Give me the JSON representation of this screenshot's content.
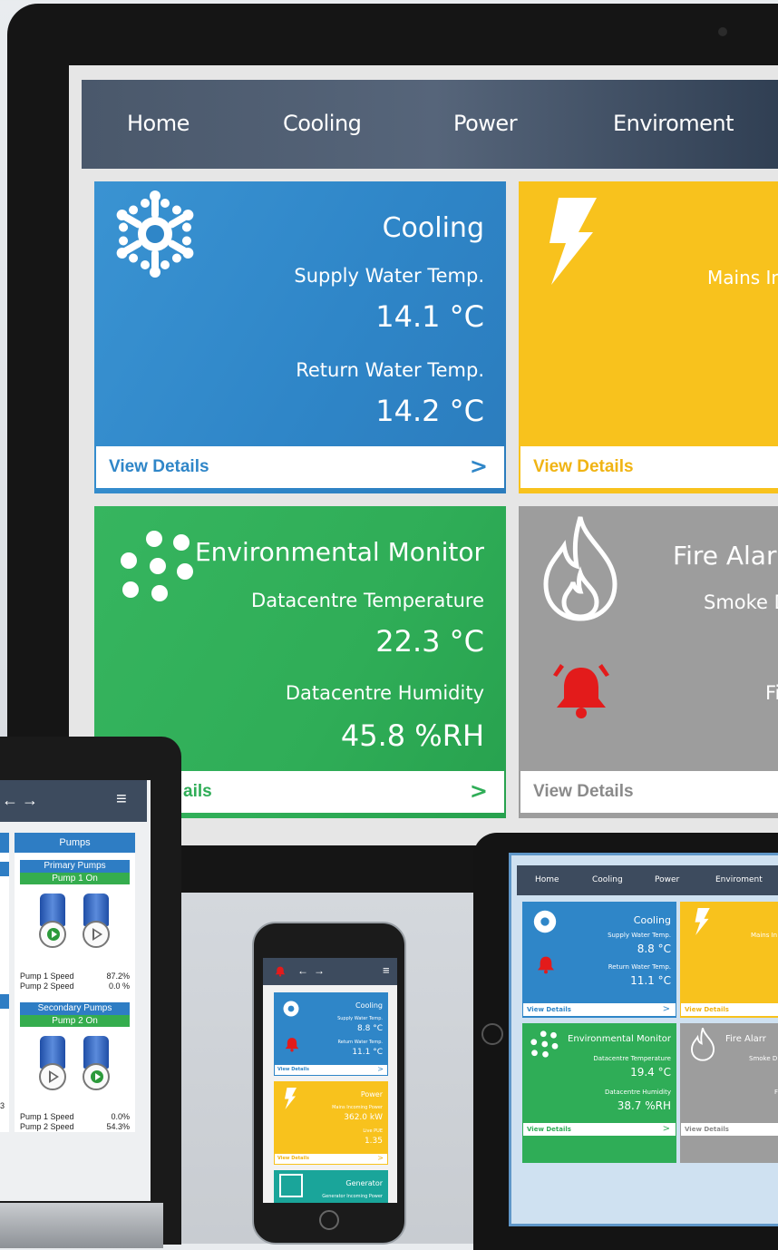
{
  "colors": {
    "cooling": "#2f86c8",
    "power": "#f8c21d",
    "environment": "#2fad57",
    "fire": "#9d9d9d",
    "nav": "#3d4b5e",
    "alarm": "#e31b1b"
  },
  "monitor": {
    "nav": [
      "Home",
      "Cooling",
      "Power",
      "Enviroment"
    ],
    "cooling": {
      "title": "Cooling",
      "label1": "Supply Water Temp.",
      "value1": "14.1 °C",
      "label2": "Return Water Temp.",
      "value2": "14.2 °C",
      "details": "View Details",
      "arrow": ">"
    },
    "power": {
      "label1": "Mains In",
      "details": "View Details"
    },
    "environment": {
      "title": "Environmental Monitor",
      "label1": "Datacentre Temperature",
      "value1": "22.3 °C",
      "label2": "Datacentre Humidity",
      "value2": "45.8 %RH",
      "details": "ails",
      "arrow": ">"
    },
    "fire": {
      "title": "Fire Alarr",
      "label1": "Smoke D",
      "label2": "Fi",
      "details": "View Details"
    }
  },
  "laptop": {
    "nav_back": "←",
    "nav_forward": "→",
    "menu": "≡",
    "panel_title": "Pumps",
    "primary": {
      "title": "Primary Pumps",
      "status": "Pump 1 On",
      "rows": [
        [
          "Pump 1 Speed",
          "87.2%"
        ],
        [
          "Pump 2 Speed",
          "0.0 %"
        ]
      ]
    },
    "secondary": {
      "title": "Secondary Pumps",
      "status": "Pump 2 On",
      "rows": [
        [
          "Pump 1 Speed",
          "0.0%"
        ],
        [
          "Pump 2 Speed",
          "54.3%"
        ]
      ]
    },
    "left_fragment": "3"
  },
  "phone": {
    "nav_back": "←",
    "nav_forward": "→",
    "menu": "≡",
    "cooling": {
      "title": "Cooling",
      "label1": "Supply Water Temp.",
      "value1": "8.8 °C",
      "label2": "Return Water Temp.",
      "value2": "11.1 °C",
      "details": "View Details",
      "arrow": ">"
    },
    "power": {
      "title": "Power",
      "label1": "Mains Incoming Power",
      "value1": "362.0 kW",
      "label2": "Live PUE",
      "value2": "1.35",
      "details": "View Details",
      "arrow": ">"
    },
    "generator": {
      "title": "Generator",
      "label1": "Generator Incoming Power"
    }
  },
  "tablet": {
    "nav": [
      "Home",
      "Cooling",
      "Power",
      "Enviroment"
    ],
    "cooling": {
      "title": "Cooling",
      "label1": "Supply Water Temp.",
      "value1": "8.8 °C",
      "label2": "Return Water Temp.",
      "value2": "11.1 °C",
      "details": "View Details",
      "arrow": ">"
    },
    "power": {
      "label1": "Mains In",
      "details": "View Details"
    },
    "environment": {
      "title": "Environmental Monitor",
      "label1": "Datacentre Temperature",
      "value1": "19.4 °C",
      "label2": "Datacentre Humidity",
      "value2": "38.7 %RH",
      "details": "View Details",
      "arrow": ">"
    },
    "fire": {
      "title": "Fire Alarr",
      "label1": "Smoke D",
      "label2": "F",
      "details": "View Details"
    }
  }
}
